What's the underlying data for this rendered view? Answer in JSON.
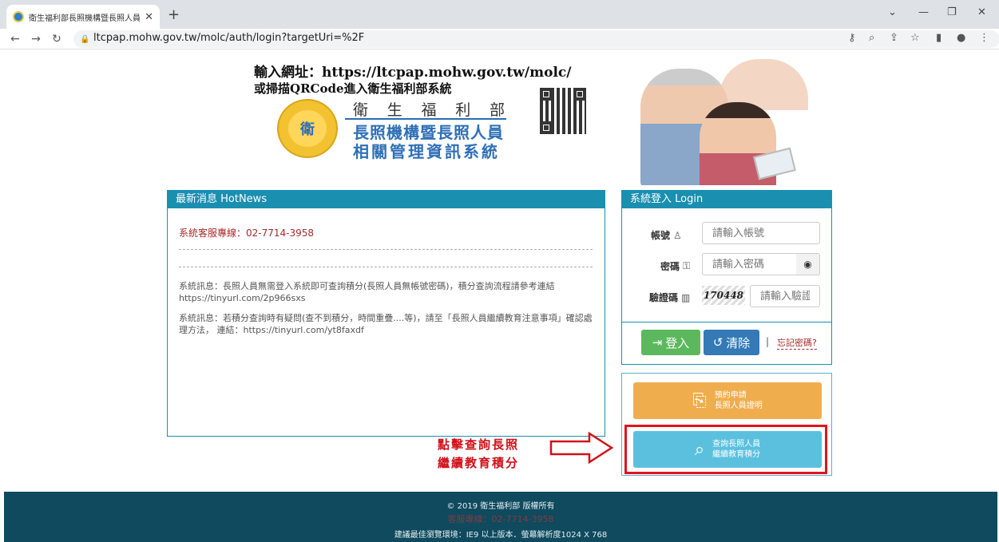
{
  "browser": {
    "tab_title": "衛生福利部長照機構暨長照人員相關管理資訊系統",
    "url": "ltcpap.mohw.gov.tw/molc/auth/login?targetUri=%2F"
  },
  "header": {
    "instruction_line1": "輸入網址：https://ltcpap.mohw.gov.tw/molc/",
    "instruction_line2": "或掃描QRCode進入衛生福利部系統",
    "ministry_chars": [
      "衛",
      "生",
      "福",
      "利",
      "部"
    ],
    "system_title_line1": "長照機構暨長照人員",
    "system_title_line2": "相關管理資訊系統",
    "emblem_text": "衛"
  },
  "news": {
    "title": "最新消息 HotNews",
    "hotline": "系統客服專線：02-7714-3958",
    "messages": [
      "系統訊息：長照人員無需登入系統即可查詢積分(長照人員無帳號密碼)，積分查詢流程請參考連結 https://tinyurl.com/2p966sxs",
      "系統訊息：若積分查詢時有疑問(查不到積分，時間重疊....等)，請至「長照人員繼續教育注意事項」確認處理方法， 連結：https://tinyurl.com/yt8faxdf"
    ]
  },
  "login": {
    "title": "系統登入 Login",
    "account_label": "帳號",
    "account_placeholder": "請輸入帳號",
    "password_label": "密碼",
    "password_placeholder": "請輸入密碼",
    "captcha_label": "驗證碼",
    "captcha_value": "170448",
    "captcha_placeholder": "請輸入驗證碼",
    "login_button": "登入",
    "clear_button": "清除",
    "separator": "|",
    "forgot_link": "忘記密碼?"
  },
  "services": {
    "apply_line1": "預約申請",
    "apply_line2": "長照人員證明",
    "query_line1": "查詢長照人員",
    "query_line2": "繼續教育積分"
  },
  "annotation": {
    "line1": "點擊查詢長照",
    "line2": "繼續教育積分",
    "color": "#d01018"
  },
  "footer": {
    "copyright": "© 2019 衛生福利部 版權所有",
    "hotline": "客服專線：02-7714-3958",
    "browser_note": "建議最佳瀏覽環境：IE9 以上版本．螢幕解析度1024 X 768"
  },
  "colors": {
    "panel_accent": "#1a8fb0",
    "login_button": "#5cb85c",
    "clear_button": "#337ab7",
    "apply_button": "#f0ad4e",
    "query_button": "#5bc0de",
    "footer_bg": "#0f4a5e"
  }
}
